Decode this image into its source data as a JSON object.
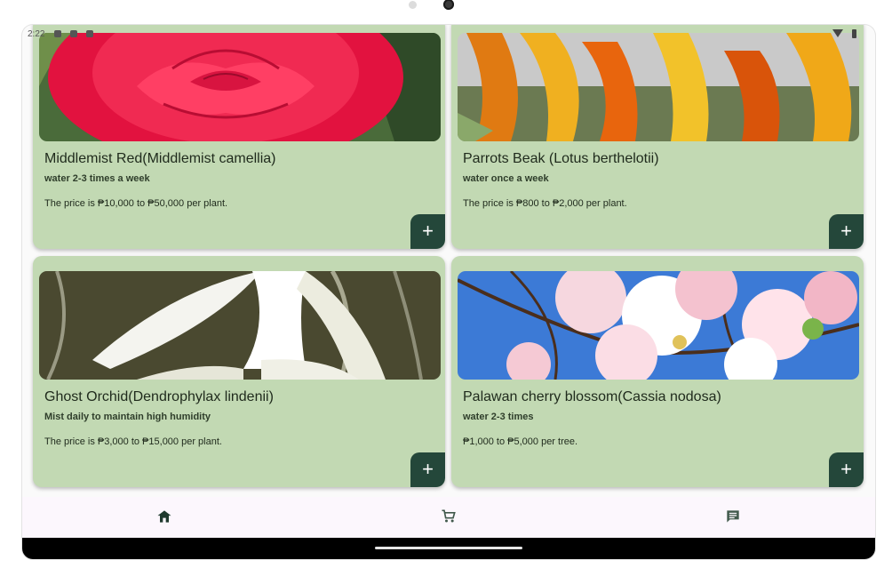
{
  "status_bar": {
    "time": "2:22"
  },
  "cards": [
    {
      "title": "Middlemist Red(Middlemist camellia)",
      "water": "water 2-3 times a week",
      "price": "The price is ₱10,000 to ₱50,000 per plant.",
      "add_label": "+"
    },
    {
      "title": "Parrots Beak (Lotus berthelotii)",
      "water": "water once a week",
      "price": "The price is ₱800 to ₱2,000 per plant.",
      "add_label": "+"
    },
    {
      "title": "Ghost Orchid(Dendrophylax lindenii)",
      "water": "Mist daily to maintain high humidity",
      "price": "The price is ₱3,000 to ₱15,000 per plant.",
      "add_label": "+"
    },
    {
      "title": "Palawan cherry blossom(Cassia nodosa)",
      "water": "water 2-3 times",
      "price": "₱1,000 to ₱5,000 per tree.",
      "add_label": "+"
    }
  ],
  "bottom_nav": {
    "items": [
      {
        "icon": "home-icon",
        "active": true
      },
      {
        "icon": "cart-icon",
        "active": false
      },
      {
        "icon": "chat-icon",
        "active": false
      }
    ]
  },
  "colors": {
    "card_bg": "#c2d9b3",
    "accent": "#24473a",
    "nav_bg": "#fcf7fd"
  }
}
